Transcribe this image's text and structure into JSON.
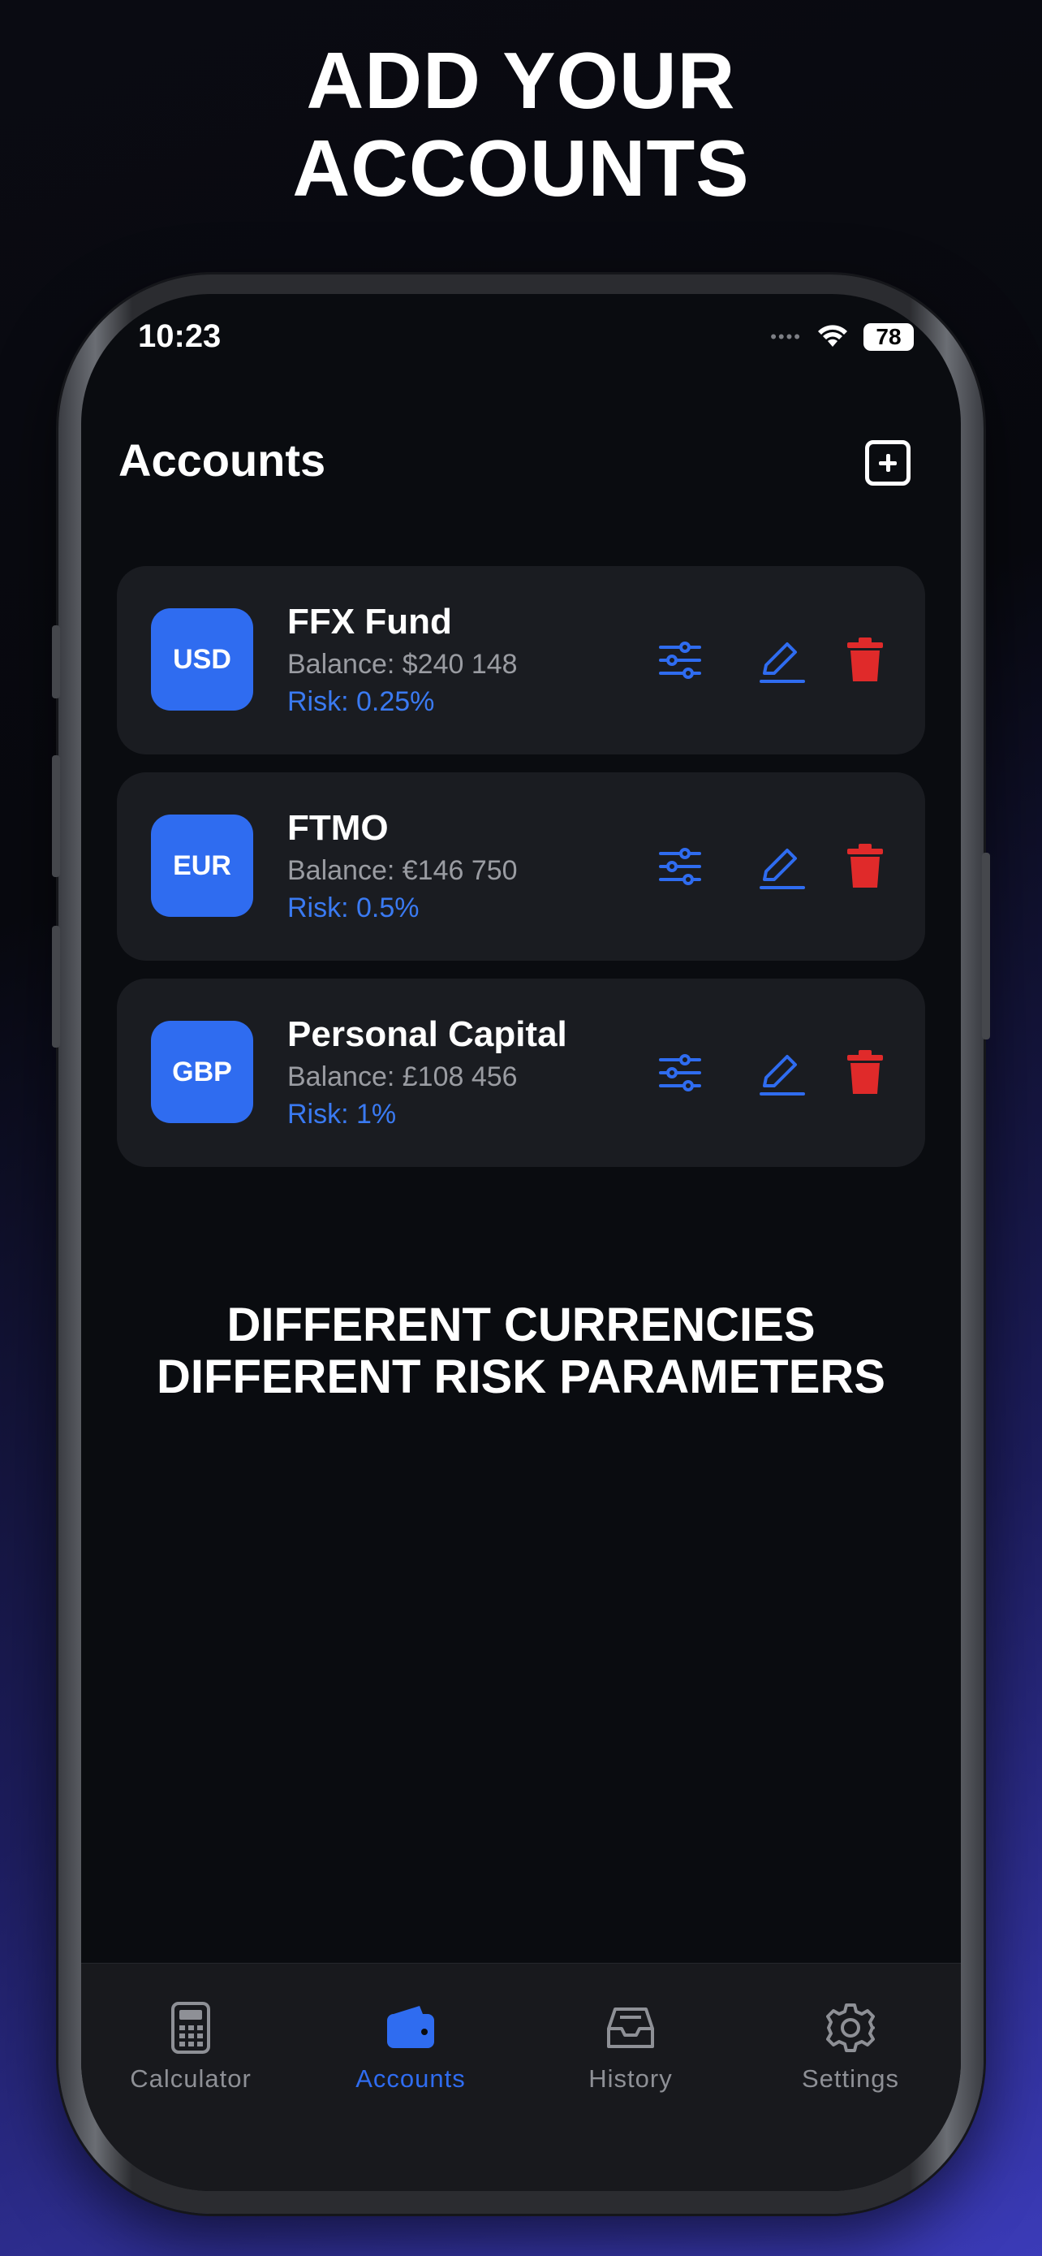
{
  "headline": [
    "ADD YOUR",
    "ACCOUNTS"
  ],
  "status_bar": {
    "time": "10:23",
    "battery": "78"
  },
  "screen": {
    "title": "Accounts"
  },
  "accounts": [
    {
      "currency": "USD",
      "name": "FFX Fund",
      "balance": "Balance: $240 148",
      "risk": "Risk: 0.25%"
    },
    {
      "currency": "EUR",
      "name": "FTMO",
      "balance": "Balance: €146 750",
      "risk": "Risk: 0.5%"
    },
    {
      "currency": "GBP",
      "name": "Personal Capital",
      "balance": "Balance: £108 456",
      "risk": "Risk: 1%"
    }
  ],
  "caption": [
    "DIFFERENT CURRENCIES",
    "DIFFERENT RISK PARAMETERS"
  ],
  "tabs": [
    {
      "label": "Calculator",
      "icon": "calculator-icon",
      "active": false
    },
    {
      "label": "Accounts",
      "icon": "wallet-icon",
      "active": true
    },
    {
      "label": "History",
      "icon": "inbox-icon",
      "active": false
    },
    {
      "label": "Settings",
      "icon": "gear-icon",
      "active": false
    }
  ],
  "colors": {
    "accent": "#2f6cf0",
    "delete": "#e02a2a",
    "card": "#1a1c21",
    "background": "#0a0c10"
  }
}
